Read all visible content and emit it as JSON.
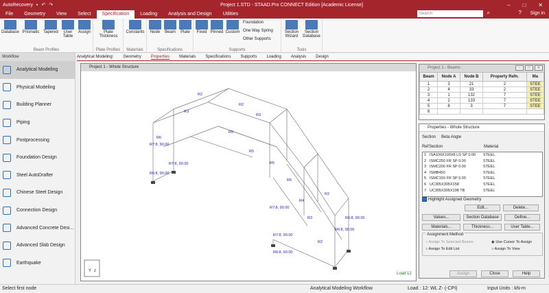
{
  "titlebar": {
    "autorecovery": "AutoRecovery",
    "title": "Project 1.STD - STAAD.Pro CONNECT Edition [Academic License]"
  },
  "menu": [
    "File",
    "Geometry",
    "View",
    "Select",
    "Specification",
    "Loading",
    "Analysis and Design",
    "Utilities"
  ],
  "search": {
    "placeholder": "Search"
  },
  "signin": "Sign in",
  "ribbon": {
    "beam_profiles": {
      "label": "Beam Profiles",
      "buttons": [
        "Database",
        "Prismatic",
        "Tapered",
        "User Table",
        "Assign"
      ]
    },
    "plate_profiles": {
      "label": "Plate Profiles",
      "buttons": [
        "Plate Thickness"
      ]
    },
    "materials": {
      "label": "Materials",
      "buttons": [
        "Constants"
      ]
    },
    "specifications": {
      "label": "Specifications",
      "buttons": [
        "Node",
        "Beam",
        "Plate"
      ]
    },
    "supports": {
      "label": "Supports",
      "buttons": [
        "Fixed",
        "Pinned",
        "Custom"
      ],
      "small": [
        "Foundation",
        "One Way Spring",
        "Other Supports"
      ]
    },
    "tools": {
      "label": "Tools",
      "buttons": [
        "Section Wizard",
        "Section Database"
      ]
    }
  },
  "workflow": {
    "header": "Workflow",
    "items": [
      {
        "label": "Analytical Modeling"
      },
      {
        "label": "Physical Modeling"
      },
      {
        "label": "Building Planner"
      },
      {
        "label": "Piping"
      },
      {
        "label": "Postprocessing"
      },
      {
        "label": "Foundation Design"
      },
      {
        "label": "Steel AutoDrafter"
      },
      {
        "label": "Chinese Steel Design"
      },
      {
        "label": "Connection Design"
      },
      {
        "label": "Advanced Concrete Desi..."
      },
      {
        "label": "Advanced Slab Design"
      },
      {
        "label": "Earthquake"
      }
    ]
  },
  "tabs": {
    "prefix": "Analytical Modeling:",
    "items": [
      "Geometry",
      "Properties",
      "Materials",
      "Specifications",
      "Supports",
      "Loading",
      "Analysis",
      "Design"
    ]
  },
  "viewport": {
    "title": "Project 1 - Whole Structure",
    "load_label": "Load 12",
    "labels": [
      "R2",
      "R3",
      "R5",
      "R4",
      "R6",
      "R7:8, 90.00",
      "R6:8, 90.00"
    ]
  },
  "beams_window": {
    "title": "Project 1 - Beams",
    "columns": [
      "Beam",
      "Node A",
      "Node B",
      "Property Refn.",
      "Ma"
    ],
    "rows": [
      [
        "1",
        "3",
        "21",
        "2",
        "STEE"
      ],
      [
        "2",
        "4",
        "33",
        "2",
        "STEE"
      ],
      [
        "3",
        "1",
        "132",
        "7",
        "STEE"
      ],
      [
        "4",
        "2",
        "133",
        "7",
        "STEE"
      ],
      [
        "5",
        "8",
        "3",
        "7",
        "STEE"
      ],
      [
        "6",
        "",
        "",
        "",
        ""
      ]
    ]
  },
  "properties": {
    "title": "Properties - Whole Structure",
    "tabs": [
      "Section",
      "Beta Angle"
    ],
    "columns": [
      "Ref",
      "Section",
      "Material"
    ],
    "rows": [
      [
        "1",
        "ISA100X100X8 LD SP 0.00",
        "STEEL"
      ],
      [
        "2",
        "ISMC250 FR SP 0.00",
        "STEEL"
      ],
      [
        "3",
        "ISMC200 FR SP 0.00",
        "STEEL"
      ],
      [
        "4",
        "ISMB450",
        "STEEL"
      ],
      [
        "5",
        "ISMC150 FR SP 0.00",
        "STEEL"
      ],
      [
        "6",
        "UC305X305X158",
        "STEEL"
      ],
      [
        "7",
        "UC305X305X198 TB",
        "STEEL"
      ]
    ],
    "highlight_label": "Highlight Assigned Geometry",
    "edit": "Edit...",
    "delete": "Delete...",
    "values": "Values...",
    "section_database": "Section Database",
    "define": "Define...",
    "materials": "Materials...",
    "thickness": "Thickness...",
    "user_table": "User Table...",
    "assignment_method": "Assignment Method",
    "radio": [
      "Assign To Selected Beams",
      "Assign To Edit List",
      "Use Cursor To Assign",
      "Assign To View"
    ],
    "assign": "Assign",
    "close": "Close",
    "help": "Help"
  },
  "status": {
    "left": "Select first node",
    "workflow": "Analytical Modeling Workflow",
    "load": "Load : 12: WL Z- (-CPI)",
    "units": "Input Units : kN-m"
  }
}
